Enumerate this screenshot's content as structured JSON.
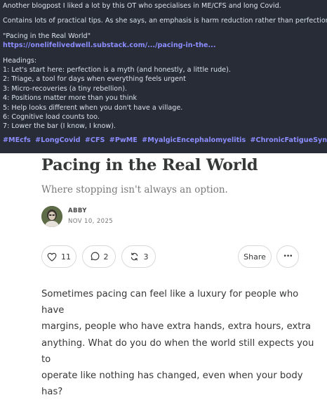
{
  "post": {
    "line1": "Another blogpost I liked a lot by this OT who specialises in ME/CFS and long Covid.",
    "line2": "Contains lots of practical tips. As she says, an emphasis is harm reduction rather than perfection",
    "quote": "\"Pacing in the Real World\"",
    "link": "https://onelifelivedwell.substack.com/.../pacing-in-the...",
    "headings_label": "Headings:",
    "headings": [
      "1: Let's start here: perfection is a myth (and honestly, a little rude).",
      "2: Triage, a tool for days when everything feels urgent",
      "3: Micro-recoveries (a tiny rebellion).",
      "4: Positions matter more than you think",
      "5: Help looks different when you don't have a village.",
      "6: Cognitive load counts too.",
      "7: Lower the bar (I know, I know)."
    ],
    "hashtags": [
      "#MEcfs",
      "#LongCovid",
      "#CFS",
      "#PwME",
      "#MyalgicEncephalomyelitis",
      "#ChronicFatigueSyndrome"
    ]
  },
  "article": {
    "title": "Pacing in the Real World",
    "subtitle": "Where stopping isn't always an option.",
    "author": "ABBY",
    "date": "NOV 10, 2025",
    "actions": {
      "likes": "11",
      "comments": "2",
      "restacks": "3",
      "share_label": "Share",
      "more_label": "•••"
    },
    "body_lines": [
      "Sometimes pacing can feel like a luxury for people who have",
      "margins, people who have extra hands, extra hours, extra",
      "anything. What do you do when the world still expects you to",
      "operate like nothing has changed, even when your body has?"
    ]
  },
  "colors": {
    "post_background": "#282c37",
    "post_text": "#d9e1e8",
    "link_accent": "#8c8dff",
    "article_text": "#363737",
    "subtitle_text": "#7a7a7a"
  },
  "icons": [
    "heart-icon",
    "comment-icon",
    "restack-icon",
    "more-icon"
  ]
}
